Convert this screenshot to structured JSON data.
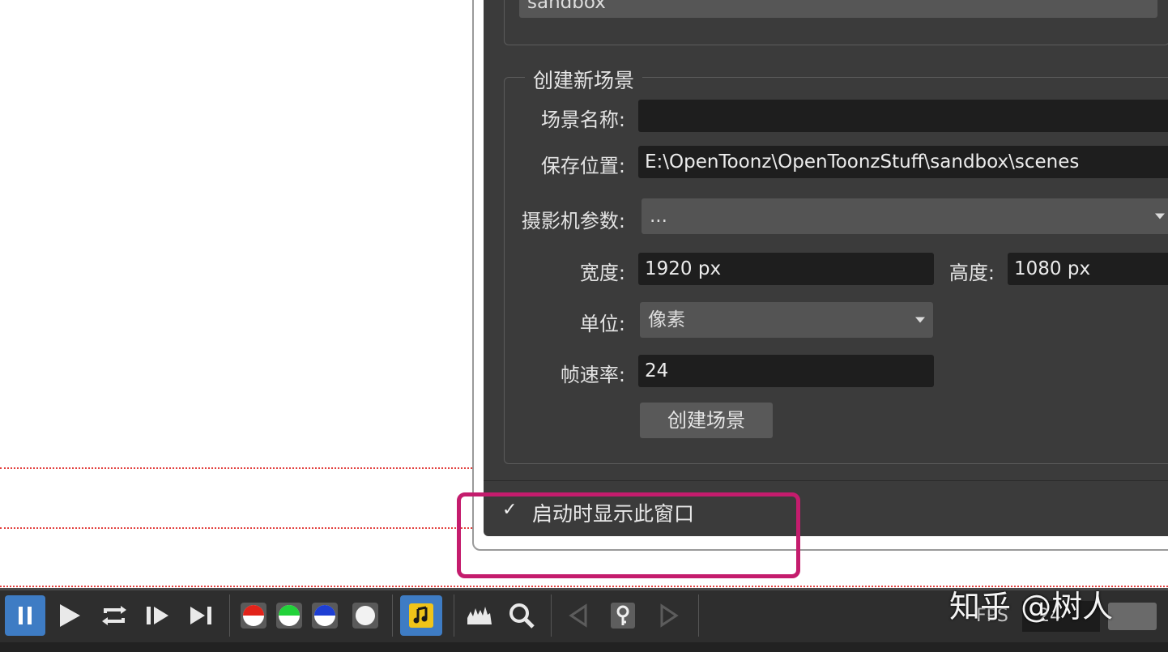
{
  "project": {
    "value": "sandbox"
  },
  "new_scene": {
    "group_title": "创建新场景",
    "scene_name_label": "场景名称:",
    "scene_name_value": "",
    "save_location_label": "保存位置:",
    "save_location_value": "E:\\OpenToonz\\OpenToonzStuff\\sandbox\\scenes",
    "camera_label": "摄影机参数:",
    "camera_value": "...",
    "width_label": "宽度:",
    "width_value": "1920 px",
    "height_label": "高度:",
    "height_value": "1080 px",
    "units_label": "单位:",
    "units_value": "像素",
    "fps_label": "帧速率:",
    "fps_value": "24",
    "create_button": "创建场景"
  },
  "startup": {
    "checkbox_label": "启动时显示此窗口",
    "checked": true
  },
  "toolbar": {
    "icons": [
      "pause-icon",
      "play-icon",
      "loop-icon",
      "next-frame-icon",
      "last-frame-icon",
      "red-channel-icon",
      "green-channel-icon",
      "blue-channel-icon",
      "alpha-channel-icon",
      "sound-icon",
      "histogram-icon",
      "zoom-icon",
      "prev-key-icon",
      "key-icon",
      "next-key-icon"
    ],
    "fps_label": "FPS",
    "fps_value": "24"
  },
  "watermark": "知乎 @树人",
  "colors": {
    "dialog_bg": "#3b3b3b",
    "field_bg": "#1e1e1e",
    "highlight": "#c41c6d",
    "toolbar_bg": "#2e2e2e",
    "sound_active": "#f0c419"
  }
}
